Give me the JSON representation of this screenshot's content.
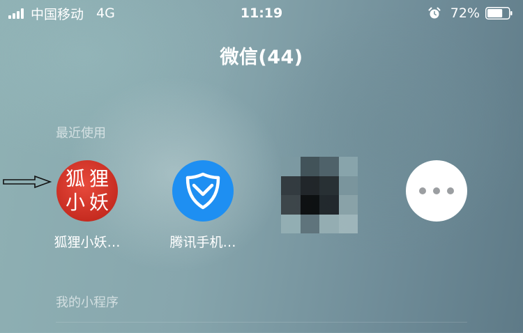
{
  "status_bar": {
    "carrier": "中国移动",
    "network": "4G",
    "time": "11:19",
    "battery_percent": "72%",
    "battery_level": 0.72,
    "icons": [
      "signal-icon",
      "alarm-icon",
      "battery-icon"
    ]
  },
  "title": "微信(44)",
  "recent_section": {
    "label": "最近使用",
    "apps": [
      {
        "name": "狐狸小妖…",
        "icon": "fox-app-icon",
        "icon_text": [
          "狐",
          "狸",
          "小",
          "妖"
        ],
        "icon_color": "#d83a2e"
      },
      {
        "name": "腾讯手机…",
        "icon": "tencent-shield-icon",
        "icon_color": "#1e8ff2"
      },
      {
        "name": "",
        "icon": "pixelated-app-icon"
      },
      {
        "name": "",
        "icon": "more-icon"
      }
    ]
  },
  "mine_section": {
    "label": "我的小程序"
  },
  "colors": {
    "accent_blue": "#1e8ff2",
    "fox_red": "#d83a2e",
    "more_dots": "#9b9ea1"
  }
}
